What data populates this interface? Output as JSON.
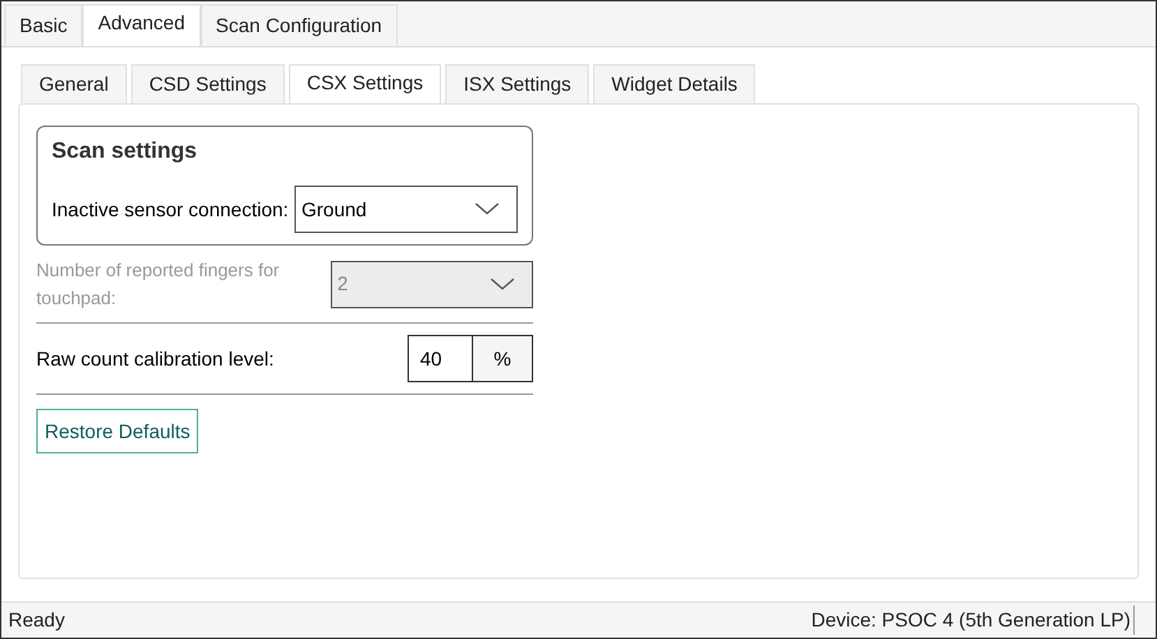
{
  "tabs": [
    {
      "label": "Basic",
      "selected": false
    },
    {
      "label": "Advanced",
      "selected": true
    },
    {
      "label": "Scan Configuration",
      "selected": false
    }
  ],
  "subtabs": [
    {
      "label": "General",
      "selected": false
    },
    {
      "label": "CSD Settings",
      "selected": false
    },
    {
      "label": "CSX Settings",
      "selected": true
    },
    {
      "label": "ISX Settings",
      "selected": false
    },
    {
      "label": "Widget Details",
      "selected": false
    }
  ],
  "scan_settings": {
    "title": "Scan settings",
    "label": "Inactive sensor connection:",
    "value": "Ground",
    "disabled": false
  },
  "fingers": {
    "label": "Number of reported fingers for touchpad:",
    "value": "2",
    "disabled": true
  },
  "calibration": {
    "label": "Raw count calibration level:",
    "value": "40",
    "unit": "%"
  },
  "restore_button": "Restore Defaults",
  "status_bar": {
    "left": "Ready",
    "right": "Device: PSOC 4 (5th Generation LP)"
  }
}
